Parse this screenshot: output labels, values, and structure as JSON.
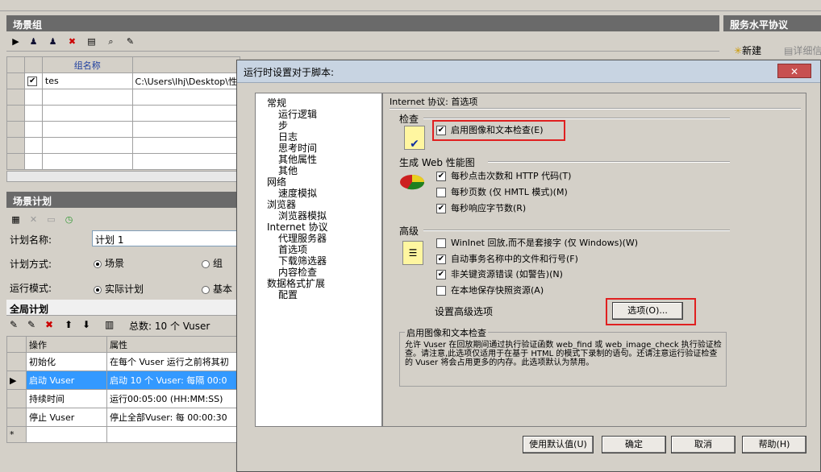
{
  "scenario_groups": {
    "title": "场景组",
    "col_name": "组名称",
    "row1_name": "tes",
    "row1_path": "C:\\Users\\lhj\\Desktop\\性"
  },
  "sla": {
    "title": "服务水平协议",
    "new_label": "新建",
    "detail_label": "详细信"
  },
  "schedule": {
    "title": "场景计划",
    "name_label": "计划名称:",
    "name_value": "计划 1",
    "mode_label": "计划方式:",
    "mode_opt1": "场景",
    "mode_opt2": "组",
    "run_label": "运行模式:",
    "run_opt1": "实际计划",
    "run_opt2": "基本"
  },
  "global": {
    "title": "全局计划",
    "total": "总数: 10 个 Vuser",
    "col_op": "操作",
    "col_attr": "属性",
    "rows": [
      {
        "op": "初始化",
        "attr": "在每个 Vuser 运行之前将其初"
      },
      {
        "op": "启动 Vuser",
        "attr": "启动 10 个 Vuser: 每隔 00:0"
      },
      {
        "op": "持续时间",
        "attr": "运行00:05:00 (HH:MM:SS)"
      },
      {
        "op": "停止 Vuser",
        "attr": "停止全部Vuser: 每 00:00:30"
      }
    ],
    "new_row_marker": "*"
  },
  "dialog": {
    "title": "运行时设置对于脚本:",
    "close": "✕",
    "tree": [
      {
        "label": "常规",
        "level": 0
      },
      {
        "label": "运行逻辑",
        "level": 1
      },
      {
        "label": "步",
        "level": 1
      },
      {
        "label": "日志",
        "level": 1
      },
      {
        "label": "思考时间",
        "level": 1
      },
      {
        "label": "其他属性",
        "level": 1
      },
      {
        "label": "其他",
        "level": 1
      },
      {
        "label": "网络",
        "level": 0
      },
      {
        "label": "速度模拟",
        "level": 1
      },
      {
        "label": "浏览器",
        "level": 0
      },
      {
        "label": "浏览器模拟",
        "level": 1
      },
      {
        "label": "Internet 协议",
        "level": 0
      },
      {
        "label": "代理服务器",
        "level": 1
      },
      {
        "label": "首选项",
        "level": 1
      },
      {
        "label": "下载筛选器",
        "level": 1
      },
      {
        "label": "内容检查",
        "level": 1
      },
      {
        "label": "数据格式扩展",
        "level": 0
      },
      {
        "label": "配置",
        "level": 1
      }
    ],
    "panel_title": "Internet 协议: 首选项",
    "check_section": "检查",
    "check_image_text": "启用图像和文本检查(E)",
    "web_perf_section": "生成 Web 性能图",
    "perf_items": [
      {
        "label": "每秒点击次数和 HTTP 代码(T)",
        "checked": true
      },
      {
        "label": "每秒页数 (仅 HMTL 模式)(M)",
        "checked": false
      },
      {
        "label": "每秒响应字节数(R)",
        "checked": true
      }
    ],
    "advanced_section": "高级",
    "adv_items": [
      {
        "label": "WinInet 回放,而不是套接字 (仅 Windows)(W)",
        "checked": false
      },
      {
        "label": "自动事务名称中的文件和行号(F)",
        "checked": true
      },
      {
        "label": "非关键资源错误 (如警告)(N)",
        "checked": true
      },
      {
        "label": "在本地保存快照资源(A)",
        "checked": false
      }
    ],
    "adv_options_label": "设置高级选项",
    "options_button": "选项(O)...",
    "desc_title": "启用图像和文本检查",
    "desc_text": "允许 Vuser 在回放期间通过执行验证函数 web_find 或 web_image_check 执行验证检查。请注意,此选项仅适用于在基于 HTML 的模式下录制的语句。还请注意运行验证检查的 Vuser 将会占用更多的内存。此选项默认为禁用。",
    "btn_default": "使用默认值(U)",
    "btn_ok": "确定",
    "btn_cancel": "取消",
    "btn_help": "帮助(H)"
  }
}
